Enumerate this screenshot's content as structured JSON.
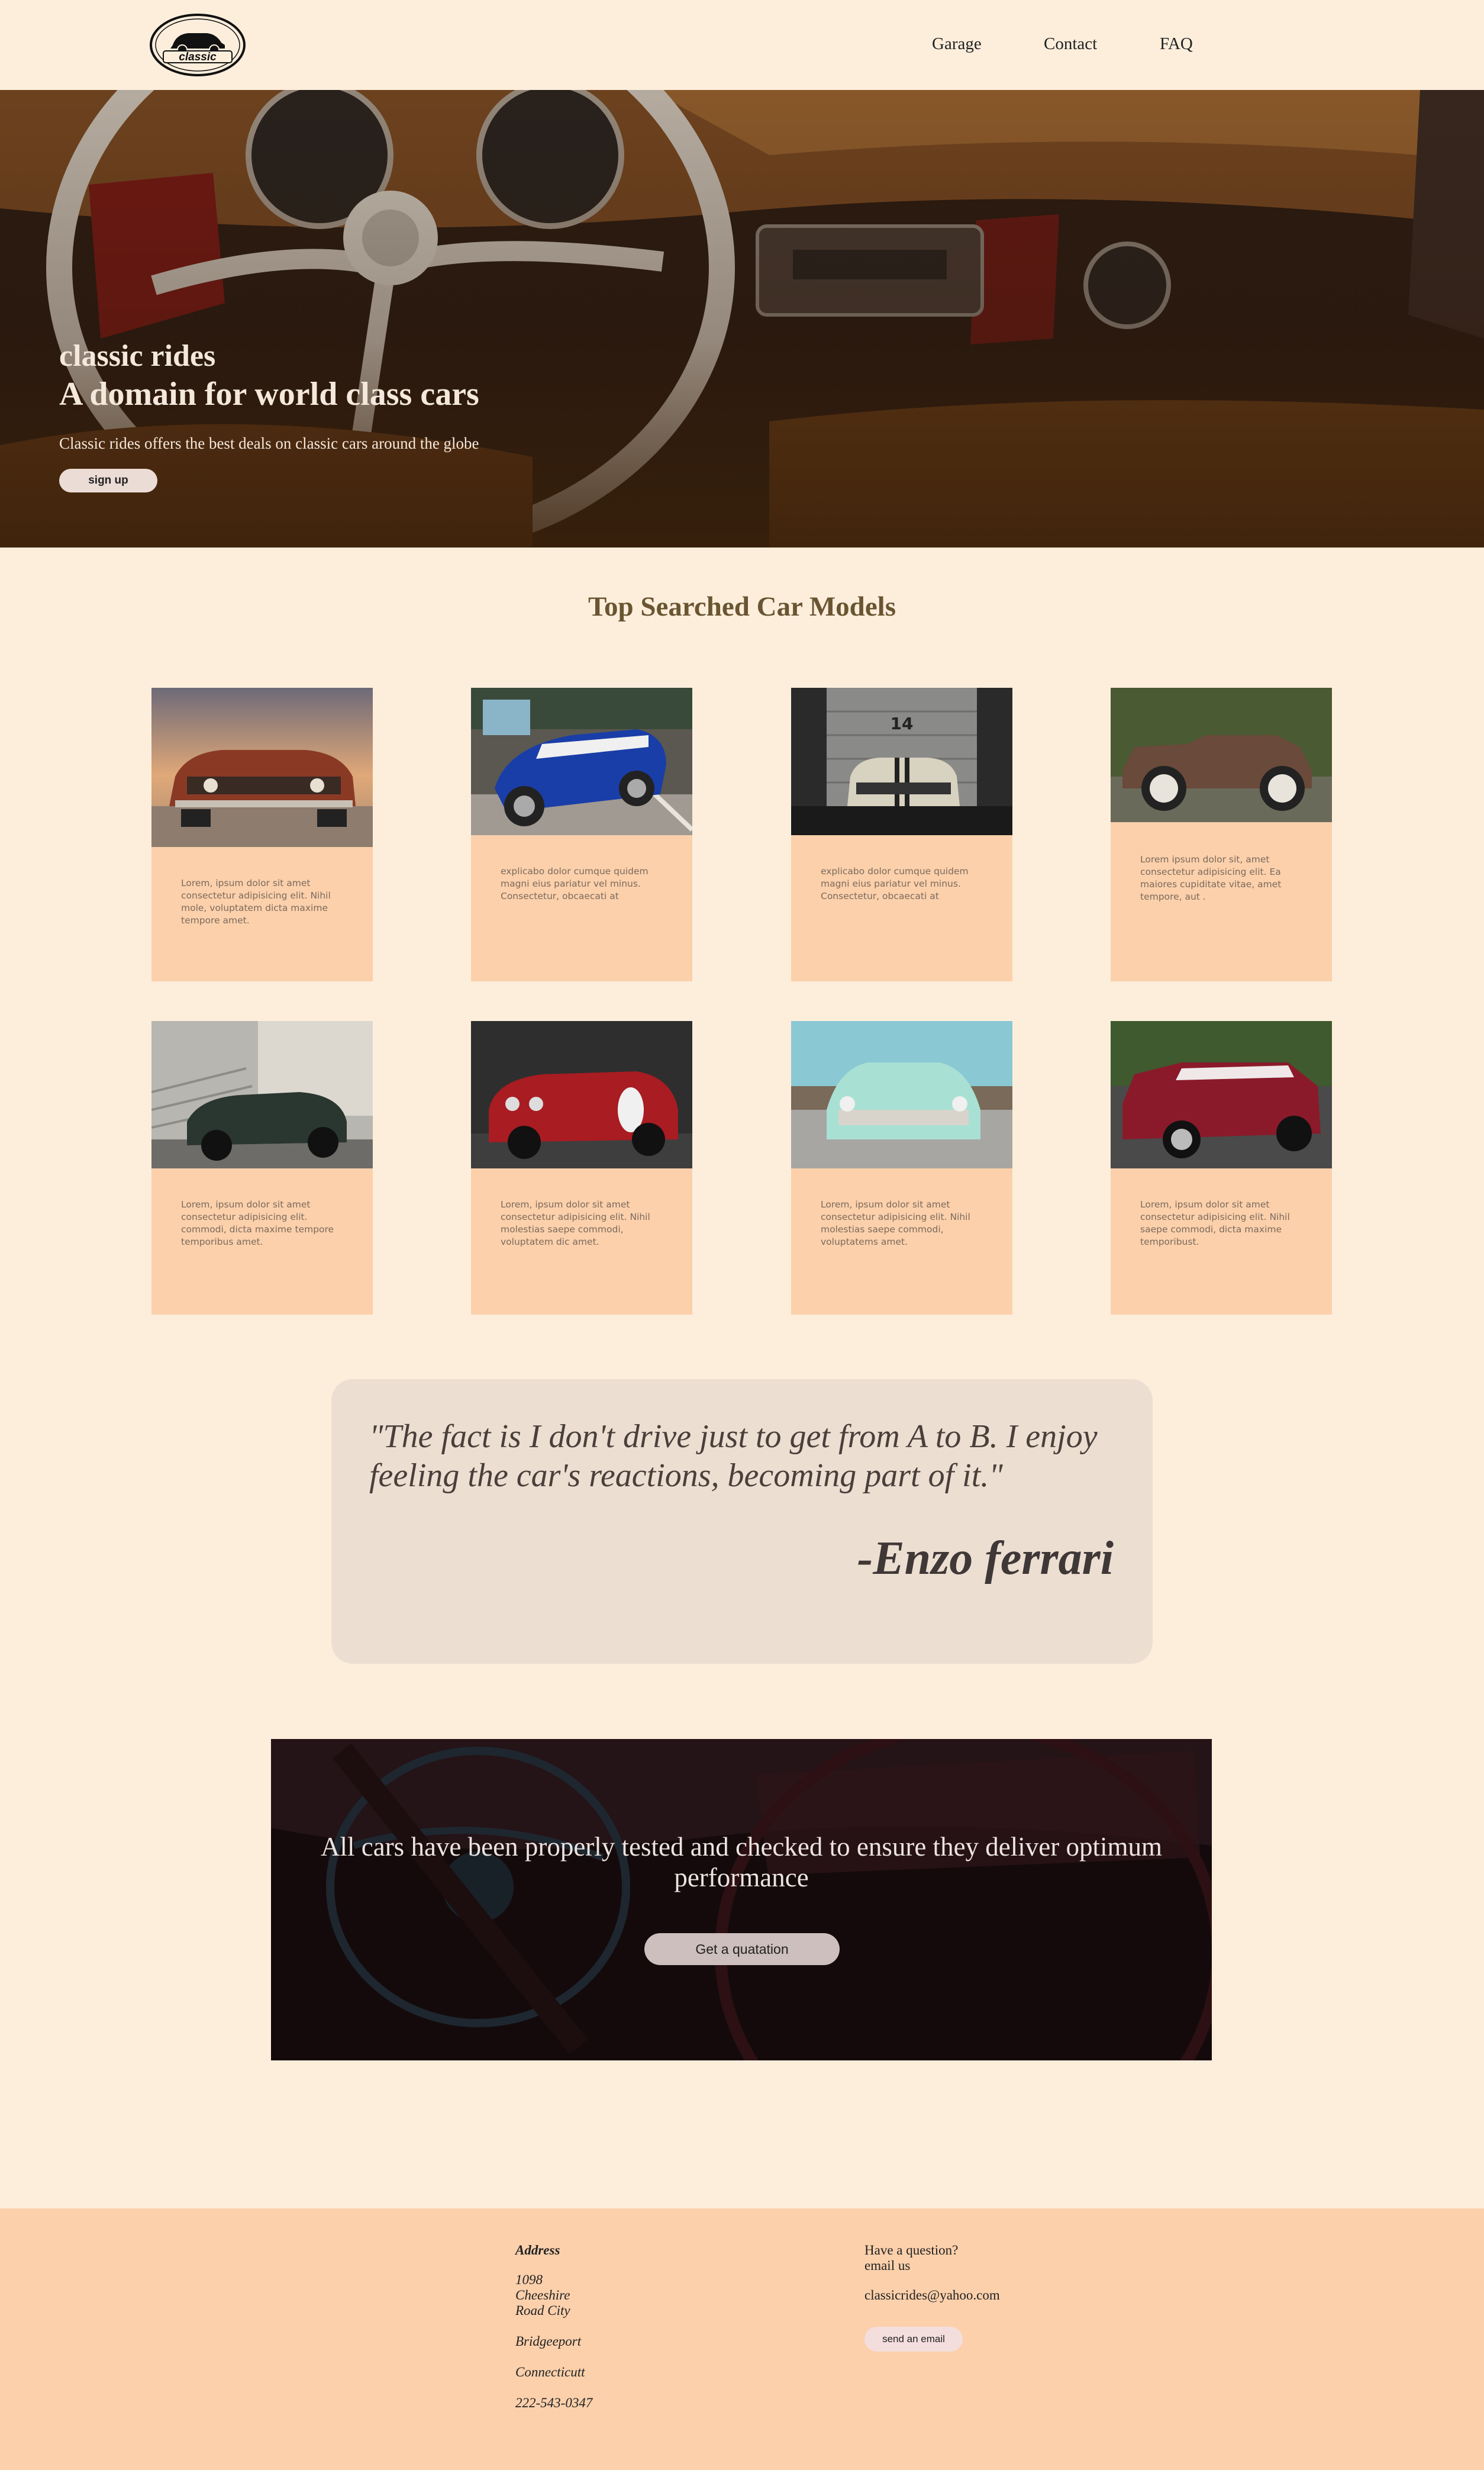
{
  "nav": {
    "logo_text": "classic",
    "links": [
      "Garage",
      "Contact",
      "FAQ"
    ]
  },
  "hero": {
    "kicker": "classic rides",
    "title": "A domain for world class cars",
    "subtitle": "Classic rides offers the best deals on classic cars around the globe",
    "button": "sign up"
  },
  "models": {
    "title": "Top Searched Car Models",
    "cards": [
      {
        "text": "Lorem, ipsum dolor sit amet consectetur adipisicing elit. Nihil mole, voluptatem dicta maxime tempore amet.",
        "image": "orange-muscle-car-sunset"
      },
      {
        "text": "explicabo dolor cumque quidem magni eius pariatur vel minus. Consectetur, obcaecati at",
        "image": "blue-cobra-roadster"
      },
      {
        "text": "explicabo dolor cumque quidem magni eius pariatur vel minus. Consectetur, obcaecati at",
        "image": "silver-mustang-garage"
      },
      {
        "text": "Lorem ipsum dolor sit, amet consectetur adipisicing elit. Ea maiores cupiditate vitae, amet tempore, aut .",
        "image": "vintage-brown-convertible"
      },
      {
        "text": "Lorem, ipsum dolor sit amet consectetur adipisicing elit. commodi, dicta maxime tempore temporibus amet.",
        "image": "dark-green-roadster"
      },
      {
        "text": "Lorem, ipsum dolor sit amet consectetur adipisicing elit. Nihil molestias saepe commodi, voluptatem dic amet.",
        "image": "red-alfa-coupe"
      },
      {
        "text": "Lorem, ipsum dolor sit amet consectetur adipisicing elit. Nihil molestias saepe commodi, voluptatems amet.",
        "image": "teal-bel-air"
      },
      {
        "text": "Lorem, ipsum dolor sit amet consectetur adipisicing elit. Nihil saepe commodi, dicta maxime temporibust.",
        "image": "red-camaro"
      }
    ]
  },
  "quote": {
    "text": "\"The fact is I don't drive just to get from A to B. I enjoy feeling the car's reactions, becoming part of it.\"",
    "author": "-Enzo ferrari"
  },
  "banner": {
    "text": "All cars have been properly tested and checked to ensure they deliver optimum performance",
    "button": "Get a quatation"
  },
  "footer": {
    "address_heading": "Address",
    "street_lines": [
      "1098",
      "Cheeshire",
      "Road City"
    ],
    "city": "Bridgeeport",
    "state": "Connecticutt",
    "phone": "222-543-0347",
    "question_lines": [
      "Have a question?",
      "email us"
    ],
    "email": "classicrides@yahoo.com",
    "button": "send an email"
  },
  "colors": {
    "page_bg": "#fdeedc",
    "card_bg": "#fbd0ab",
    "quote_bg": "#ecdfd2",
    "title_brown": "#6a5532"
  }
}
